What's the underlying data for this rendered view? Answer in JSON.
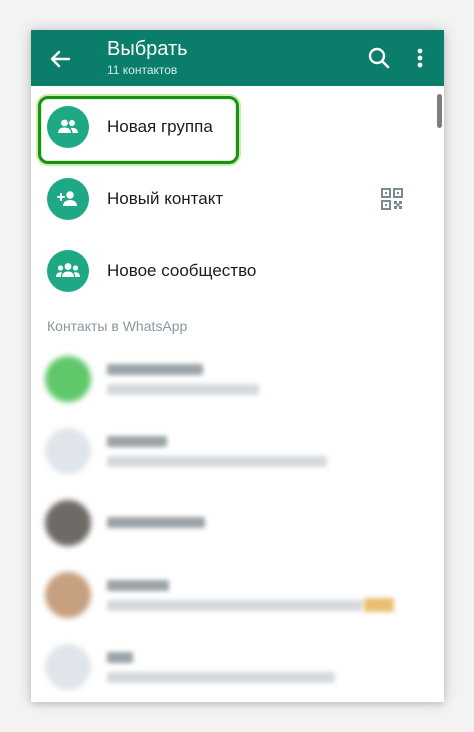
{
  "header": {
    "title": "Выбрать",
    "subtitle": "11 контактов",
    "back_icon": "arrow-left-icon",
    "search_icon": "search-icon",
    "more_icon": "more-vertical-icon"
  },
  "actions": [
    {
      "label": "Новая группа",
      "icon": "group-icon"
    },
    {
      "label": "Новый контакт",
      "icon": "add-person-icon",
      "trailing_icon": "qr-code-icon"
    },
    {
      "label": "Новое сообщество",
      "icon": "community-icon"
    }
  ],
  "section_header": "Контакты в WhatsApp",
  "colors": {
    "brand": "#0a7d6b",
    "accent": "#1fa885",
    "highlight": "#1b8f1b"
  }
}
